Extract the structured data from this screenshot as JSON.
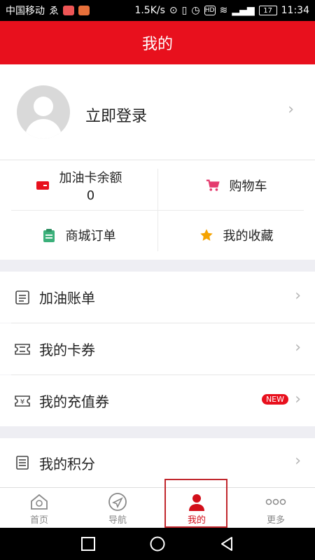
{
  "status_bar": {
    "carrier": "中国移动",
    "extra": "ゑ",
    "speed": "1.5K/s",
    "hd": "HD",
    "battery": "17",
    "time": "11:34"
  },
  "header": {
    "title": "我的"
  },
  "profile": {
    "login_label": "立即登录"
  },
  "quick_actions": {
    "card_balance": {
      "label": "加油卡余额",
      "value": "0"
    },
    "cart": {
      "label": "购物车"
    },
    "orders": {
      "label": "商城订单"
    },
    "favorites": {
      "label": "我的收藏"
    }
  },
  "menu": {
    "items": [
      {
        "label": "加油账单"
      },
      {
        "label": "我的卡券"
      },
      {
        "label": "我的充值券",
        "badge": "NEW"
      },
      {
        "label": "我的积分"
      }
    ]
  },
  "tabbar": {
    "tabs": [
      {
        "label": "首页"
      },
      {
        "label": "导航"
      },
      {
        "label": "我的"
      },
      {
        "label": "更多"
      }
    ],
    "active": "我的"
  },
  "colors": {
    "brand_red": "#e8101d",
    "cart_pink": "#e43b6e",
    "order_green": "#3bb07a",
    "star_yellow": "#f5a300"
  }
}
